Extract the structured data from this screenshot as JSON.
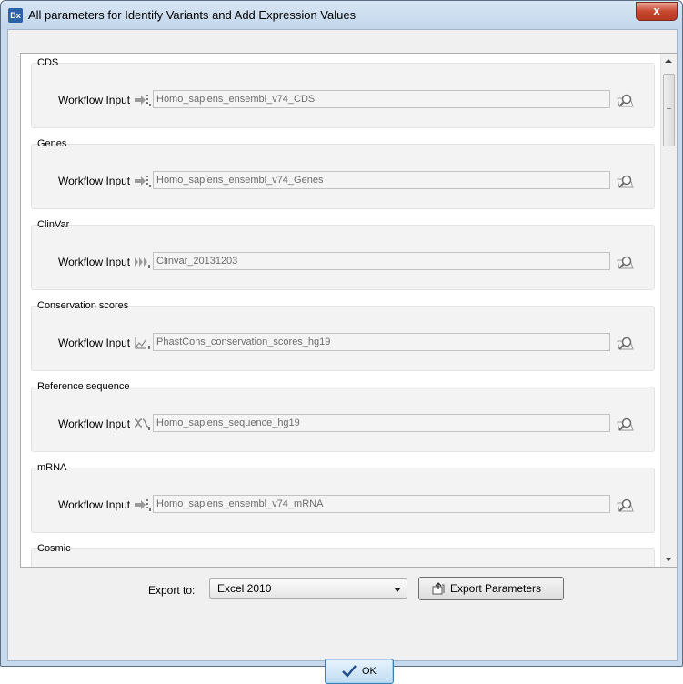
{
  "window": {
    "app_icon_text": "Bx",
    "title": "All parameters for Identify Variants and Add Expression Values",
    "close_glyph": "x"
  },
  "groups": [
    {
      "label": "CDS",
      "input_label": "Workflow Input",
      "value": "Homo_sapiens_ensembl_v74_CDS",
      "icon": "track-icon"
    },
    {
      "label": "Genes",
      "input_label": "Workflow Input",
      "value": "Homo_sapiens_ensembl_v74_Genes",
      "icon": "track-icon"
    },
    {
      "label": "ClinVar",
      "input_label": "Workflow Input",
      "value": "Clinvar_20131203",
      "icon": "variant-track-icon"
    },
    {
      "label": "Conservation scores",
      "input_label": "Workflow Input",
      "value": "PhastCons_conservation_scores_hg19",
      "icon": "graph-track-icon"
    },
    {
      "label": "Reference sequence",
      "input_label": "Workflow Input",
      "value": "Homo_sapiens_sequence_hg19",
      "icon": "sequence-track-icon"
    },
    {
      "label": "mRNA",
      "input_label": "Workflow Input",
      "value": "Homo_sapiens_ensembl_v74_mRNA",
      "icon": "track-icon"
    },
    {
      "label": "Cosmic",
      "input_label": "",
      "value": "",
      "icon": ""
    }
  ],
  "footer": {
    "export_label": "Export to:",
    "export_format": "Excel 2010",
    "export_button": "Export Parameters",
    "ok_button": "OK"
  },
  "colors": {
    "accent": "#3c7fb1",
    "close_button": "#c7472f"
  }
}
